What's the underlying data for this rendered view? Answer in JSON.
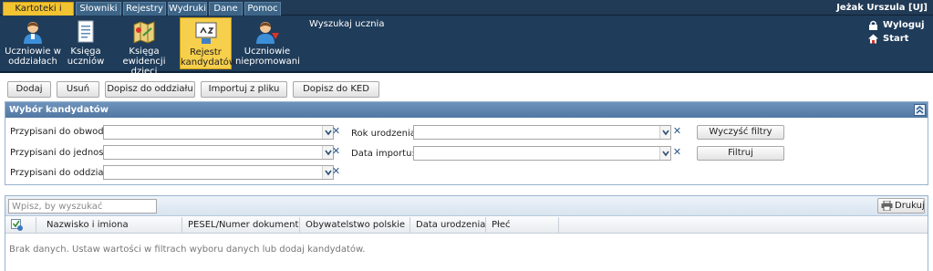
{
  "menu": {
    "tabs": [
      {
        "label": "Kartoteki i księgi"
      },
      {
        "label": "Słowniki"
      },
      {
        "label": "Rejestry"
      },
      {
        "label": "Wydruki"
      },
      {
        "label": "Dane"
      },
      {
        "label": "Pomoc"
      }
    ],
    "user": "Jeżak Urszula [UJ]"
  },
  "ribbon": {
    "title": "Wyszukaj ucznia",
    "buttons": [
      {
        "line1": "Uczniowie w",
        "line2": "oddziałach"
      },
      {
        "line1": "Księga",
        "line2": "uczniów"
      },
      {
        "line1": "Księga",
        "line2": "ewidencji dzieci"
      },
      {
        "line1": "Rejestr",
        "line2": "kandydatów"
      },
      {
        "line1": "Uczniowie",
        "line2": "niepromowani"
      }
    ],
    "logout": "Wyloguj",
    "start": "Start"
  },
  "toolbar": {
    "add": "Dodaj",
    "remove": "Usuń",
    "assign": "Dopisz do oddziału",
    "import": "Importuj z pliku",
    "ked": "Dopisz do KED"
  },
  "filters": {
    "title": "Wybór kandydatów",
    "district_label": "Przypisani do obwodu:",
    "unit_label": "Przypisani do jednostki:",
    "class_label": "Przypisani do oddziału:",
    "birth_year_label": "Rok urodzenia:",
    "import_date_label": "Data importu:",
    "clear_button": "Wyczyść filtry",
    "filter_button": "Filtruj"
  },
  "grid": {
    "search_placeholder": "Wpisz, by wyszukać",
    "print_button": "Drukuj",
    "columns": [
      "Nazwisko i imiona",
      "PESEL/Numer dokumentu",
      "Obywatelstwo polskie",
      "Data urodzenia",
      "Płeć"
    ],
    "empty_message": "Brak danych. Ustaw wartości w filtrach wyboru danych lub dodaj kandydatów."
  },
  "colors": {
    "navy": "#1f3c5a",
    "active_yellow": "#f6cf4c",
    "panel_header": "#5d84ae"
  }
}
